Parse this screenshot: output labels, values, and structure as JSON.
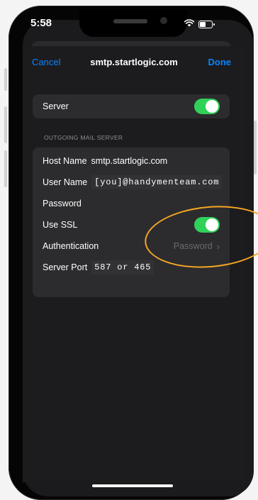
{
  "status_bar": {
    "time": "5:58",
    "wifi_icon": "wifi-icon",
    "battery_icon": "battery-icon"
  },
  "nav": {
    "cancel": "Cancel",
    "title": "smtp.startlogic.com",
    "done": "Done"
  },
  "server_row": {
    "label": "Server",
    "enabled": true
  },
  "outgoing": {
    "header": "OUTGOING MAIL SERVER",
    "host_label": "Host Name",
    "host_value": "smtp.startlogic.com",
    "user_label": "User Name",
    "user_value": "[you]@handymenteam.com",
    "password_label": "Password",
    "ssl_label": "Use SSL",
    "ssl_enabled": true,
    "auth_label": "Authentication",
    "auth_value": "Password",
    "port_label": "Server Port",
    "port_value": "587 or 465"
  },
  "colors": {
    "accent": "#0a84ff",
    "toggle_on": "#30d158",
    "highlight": "#f5a623",
    "background": "#1c1c1e",
    "group": "#2c2c2e"
  }
}
